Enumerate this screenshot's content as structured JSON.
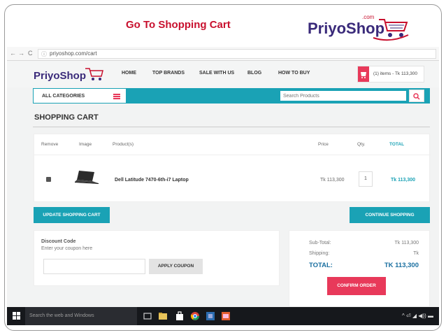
{
  "slide": {
    "title": "Go To Shopping Cart",
    "logo_text": "PriyoShop",
    "logo_com": ".com"
  },
  "browser": {
    "back": "←",
    "forward": "→",
    "reload": "C",
    "url": "priyoshop.com/cart",
    "info_icon": "ⓘ"
  },
  "site": {
    "logo_text": "PriyoShop",
    "nav": [
      "HOME",
      "TOP BRANDS",
      "SALE WITH US",
      "BLOG",
      "HOW TO BUY"
    ],
    "cart_summary": "(1) items - Tk 113,300",
    "categories_label": "ALL CATEGORIES",
    "search_placeholder": "Search Products"
  },
  "cart": {
    "heading": "SHOPPING CART",
    "columns": {
      "remove": "Remove",
      "image": "Image",
      "product": "Product(s)",
      "price": "Price",
      "qty": "Qty.",
      "total": "TOTAL"
    },
    "items": [
      {
        "name": "Dell Latitude 7470-6th-i7 Laptop",
        "price": "Tk 113,300",
        "qty": "1",
        "total": "Tk 113,300"
      }
    ],
    "update_label": "UPDATE SHOPPING CART",
    "continue_label": "CONTINUE SHOPPING"
  },
  "discount": {
    "title": "Discount Code",
    "subtitle": "Enter your coupon here",
    "apply_label": "APPLY COUPON"
  },
  "totals": {
    "subtotal_label": "Sub-Total:",
    "subtotal_value": "Tk 113,300",
    "shipping_label": "Shipping:",
    "shipping_value": "Tk",
    "total_label": "TOTAL:",
    "total_value": "TK 113,300",
    "confirm_label": "CONFIRM ORDER"
  },
  "taskbar": {
    "search_placeholder": "Search the web and Windows",
    "tray": "^ ⏎ ◢ ◀)) ▬"
  },
  "colors": {
    "teal": "#1aa2b5",
    "pink": "#e8395a",
    "title_red": "#c8102e",
    "brand_purple": "#3a2a7a"
  }
}
